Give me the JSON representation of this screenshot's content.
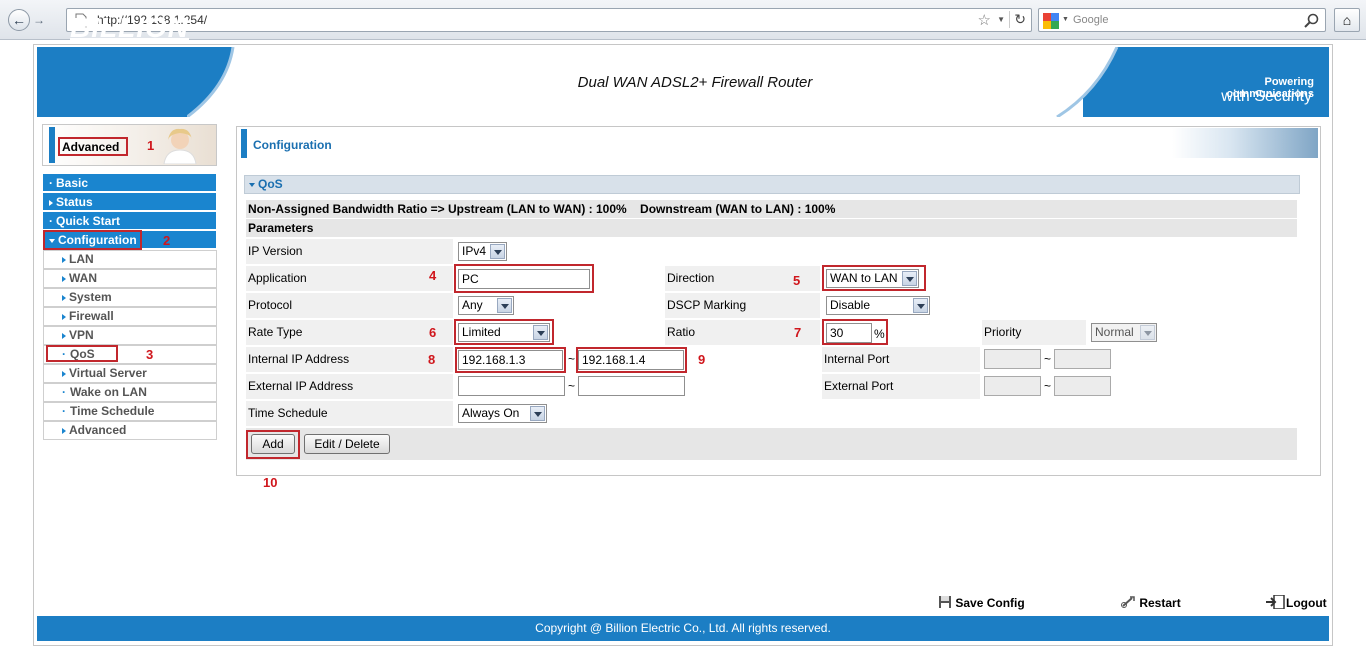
{
  "browser": {
    "url": "http://192.168.1.254/",
    "search_placeholder": "Google"
  },
  "header": {
    "brand": "BILLION",
    "product_title": "Dual WAN ADSL2+ Firewall Router",
    "slogan_small": "Powering communications",
    "slogan_large": "with Security"
  },
  "sidebar": {
    "mode_label": "Advanced",
    "main_items": [
      {
        "label": "Basic"
      },
      {
        "label": "Status"
      },
      {
        "label": "Quick Start"
      },
      {
        "label": "Configuration"
      }
    ],
    "sub_items": [
      {
        "label": "LAN"
      },
      {
        "label": "WAN"
      },
      {
        "label": "System"
      },
      {
        "label": "Firewall"
      },
      {
        "label": "VPN"
      },
      {
        "label": "QoS"
      },
      {
        "label": "Virtual Server"
      },
      {
        "label": "Wake on LAN"
      },
      {
        "label": "Time Schedule"
      },
      {
        "label": "Advanced"
      }
    ]
  },
  "main": {
    "section_title": "Configuration",
    "qos_title": "QoS",
    "bandwidth_ratio_text": "Non-Assigned Bandwidth Ratio => Upstream (LAN to WAN) : 100%    Downstream (WAN to LAN) : 100%",
    "parameters_title": "Parameters",
    "form": {
      "ip_version_label": "IP Version",
      "ip_version_value": "IPv4",
      "application_label": "Application",
      "application_value": "PC",
      "direction_label": "Direction",
      "direction_value": "WAN to LAN",
      "protocol_label": "Protocol",
      "protocol_value": "Any",
      "dscp_label": "DSCP Marking",
      "dscp_value": "Disable",
      "rate_type_label": "Rate Type",
      "rate_type_value": "Limited",
      "ratio_label": "Ratio",
      "ratio_value": "30",
      "ratio_unit": "%",
      "priority_label": "Priority",
      "priority_value": "Normal",
      "internal_ip_label": "Internal IP Address",
      "internal_ip_start": "192.168.1.3",
      "internal_ip_end": "192.168.1.4",
      "internal_port_label": "Internal Port",
      "external_ip_label": "External IP Address",
      "external_port_label": "External Port",
      "time_schedule_label": "Time Schedule",
      "time_schedule_value": "Always On",
      "range_separator": "~"
    },
    "buttons": {
      "add": "Add",
      "edit_delete": "Edit / Delete"
    }
  },
  "annotations": [
    "1",
    "2",
    "3",
    "4",
    "5",
    "6",
    "7",
    "8",
    "9",
    "10"
  ],
  "bottom_links": {
    "save_config": "Save Config",
    "restart": "Restart",
    "logout": "Logout"
  },
  "footer": {
    "copyright": "Copyright @ Billion Electric Co., Ltd. All rights reserved."
  },
  "colors": {
    "brand_blue": "#1c7ec4",
    "annotation_red": "#c1272d"
  }
}
